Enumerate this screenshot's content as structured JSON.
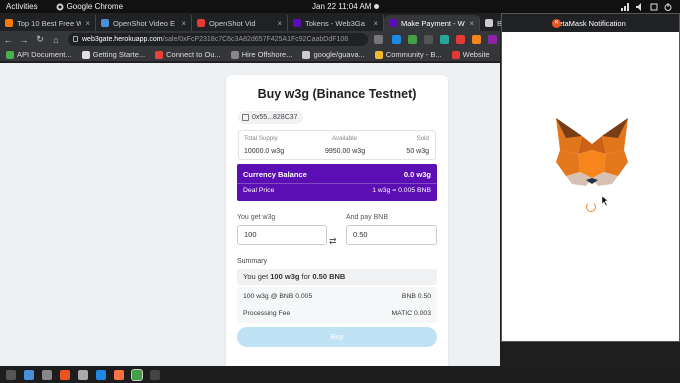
{
  "system_bar": {
    "activities": "Activities",
    "app_name": "Google Chrome",
    "datetime": "Jan 22  11:04 AM"
  },
  "tabs": [
    {
      "label": "Top 10 Best Free W",
      "color": "#f57c00"
    },
    {
      "label": "OpenShot Video E",
      "color": "#4a90d9"
    },
    {
      "label": "OpenShot Vid",
      "color": "#e53935"
    },
    {
      "label": "Tokens - Web3Ga",
      "color": "#5b0eb3"
    },
    {
      "label": "Make Payment - W",
      "color": "#5b0eb3",
      "active": true
    },
    {
      "label": "BN",
      "color": "#cccccc"
    }
  ],
  "address_bar": {
    "host": "web3gate.herokuapp.com",
    "path": "/sale/0xFcP2318c7C6c3A82d657F425A1Fc92CaabDdF108"
  },
  "bookmarks": [
    {
      "label": "API Document...",
      "color": "#4caf50"
    },
    {
      "label": "Getting Starte...",
      "color": "#e0e0e0"
    },
    {
      "label": "Connect to Ou...",
      "color": "#ea4335"
    },
    {
      "label": "Hire Offshore...",
      "color": "#888888"
    },
    {
      "label": "google/guava...",
      "color": "#cccccc"
    },
    {
      "label": "Community - B...",
      "color": "#f3ba2f"
    },
    {
      "label": "Website",
      "color": "#e53935"
    }
  ],
  "sale": {
    "title": "Buy w3g (Binance Testnet)",
    "contract_short": "0x55...828C37",
    "stats": {
      "total_supply_label": "Total Supply",
      "total_supply": "10000.0 w3g",
      "available_label": "Available",
      "available": "9950.00 w3g",
      "sold_label": "Sold",
      "sold": "50 w3g"
    },
    "currency_balance_label": "Currency Balance",
    "currency_balance": "0.0 w3g",
    "deal_price_label": "Deal Price",
    "deal_price": "1 w3g = 0.005 BNB",
    "you_get_label": "You get",
    "you_get_token": "w3g",
    "you_get_value": "100",
    "and_pay_label": "And pay",
    "and_pay_token": "BNB",
    "and_pay_value": "0.50",
    "summary_label": "Summary",
    "summary_prefix": "You get",
    "summary_amount": "100 w3g",
    "summary_for": "for",
    "summary_price": "0.50 BNB",
    "line1_left": "100 w3g @ BNB 0.005",
    "line1_right": "BNB 0.50",
    "line2_left": "Processing Fee",
    "line2_right": "MATIC 0.003",
    "buy_label": "Buy"
  },
  "metamask": {
    "title": "MetaMask Notification"
  }
}
